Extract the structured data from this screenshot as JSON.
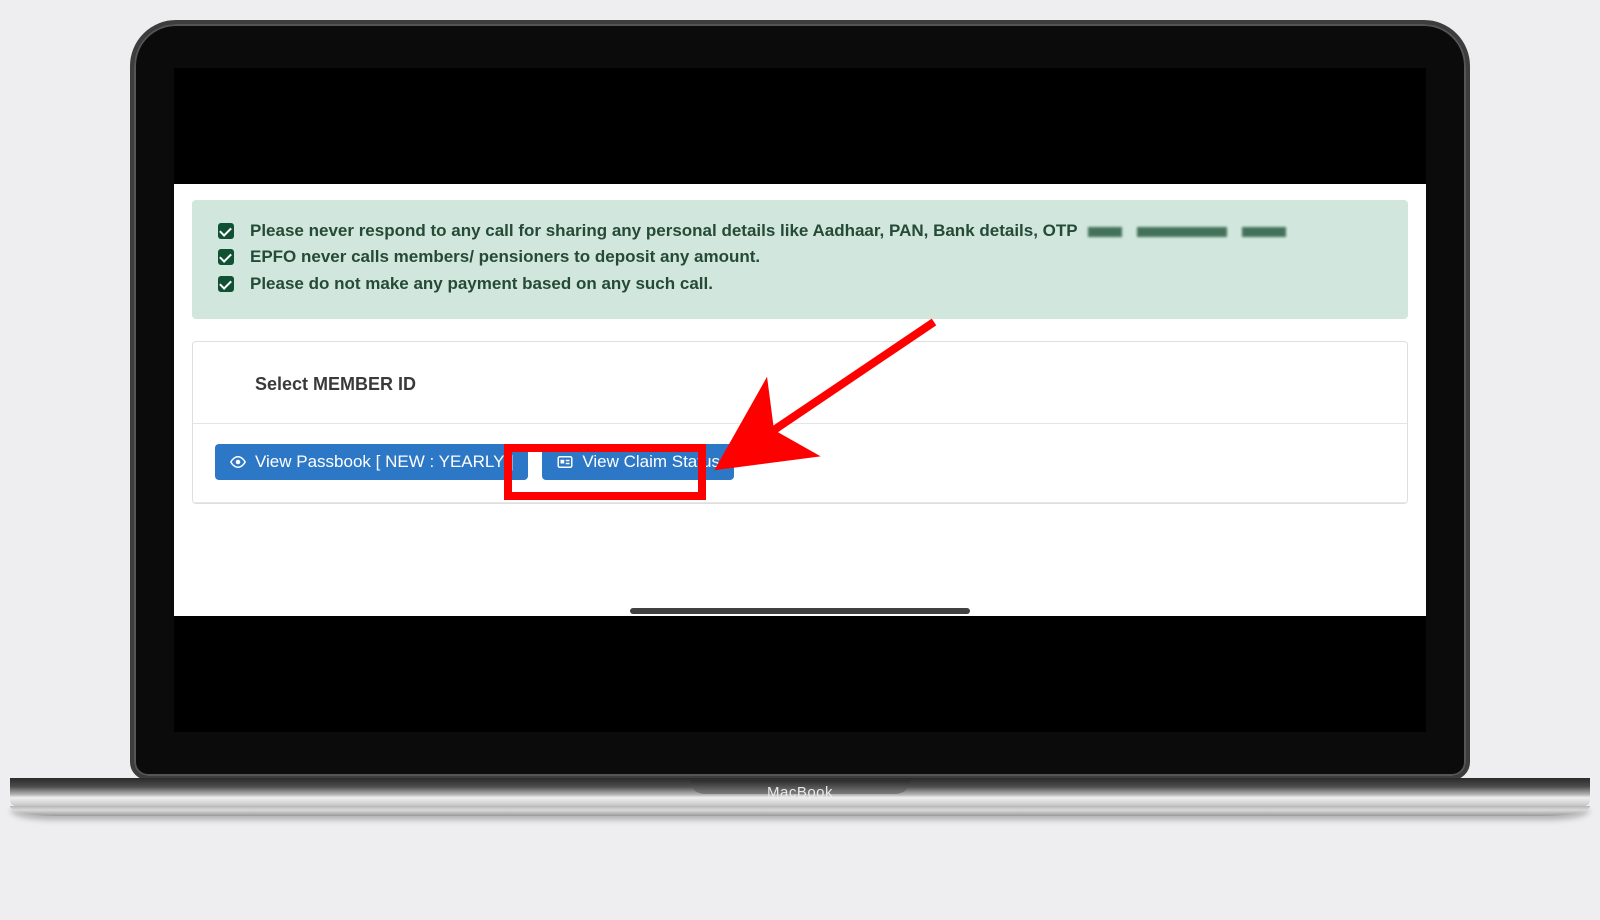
{
  "device": {
    "brand_label": "MacBook"
  },
  "alert": {
    "items": [
      "Please never respond to any call for sharing any personal details like Aadhaar, PAN, Bank details, OTP",
      "EPFO never calls members/ pensioners to deposit any amount.",
      "Please do not make any payment based on any such call."
    ]
  },
  "card": {
    "title": "Select MEMBER ID",
    "buttons": {
      "view_passbook": "View Passbook [ NEW : YEARLY ]",
      "view_claim_status": "View Claim Status"
    }
  },
  "annotation": {
    "highlight_target": "view-claim-status-button",
    "highlight_color": "#ff0000"
  }
}
